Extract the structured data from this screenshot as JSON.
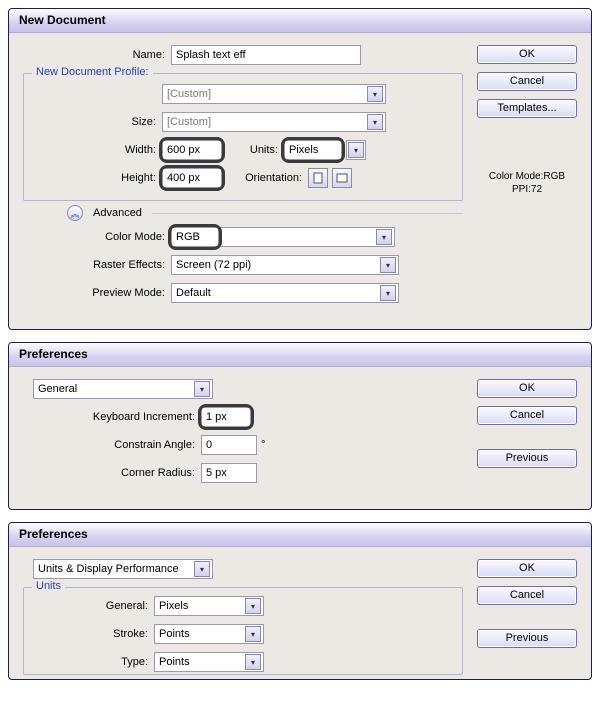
{
  "newDoc": {
    "title": "New Document",
    "name_label": "Name:",
    "name_value": "Splash text eff",
    "profile_label": "New Document Profile:",
    "profile_value": "[Custom]",
    "size_label": "Size:",
    "size_value": "[Custom]",
    "width_label": "Width:",
    "width_value": "600 px",
    "units_label": "Units:",
    "units_value": "Pixels",
    "height_label": "Height:",
    "height_value": "400 px",
    "orientation_label": "Orientation:",
    "advanced_label": "Advanced",
    "color_mode_label": "Color Mode:",
    "color_mode_value": "RGB",
    "raster_label": "Raster Effects:",
    "raster_value": "Screen (72 ppi)",
    "preview_label": "Preview Mode:",
    "preview_value": "Default",
    "ok": "OK",
    "cancel": "Cancel",
    "templates": "Templates...",
    "info1": "Color Mode:RGB",
    "info2": "PPI:72"
  },
  "prefs1": {
    "title": "Preferences",
    "section": "General",
    "ki_label": "Keyboard Increment:",
    "ki_value": "1 px",
    "ca_label": "Constrain Angle:",
    "ca_value": "0",
    "cr_label": "Corner Radius:",
    "cr_value": "5 px",
    "ok": "OK",
    "cancel": "Cancel",
    "previous": "Previous"
  },
  "prefs2": {
    "title": "Preferences",
    "section": "Units & Display Performance",
    "units_legend": "Units",
    "general_label": "General:",
    "general_value": "Pixels",
    "stroke_label": "Stroke:",
    "stroke_value": "Points",
    "type_label": "Type:",
    "type_value": "Points",
    "ok": "OK",
    "cancel": "Cancel",
    "previous": "Previous"
  }
}
